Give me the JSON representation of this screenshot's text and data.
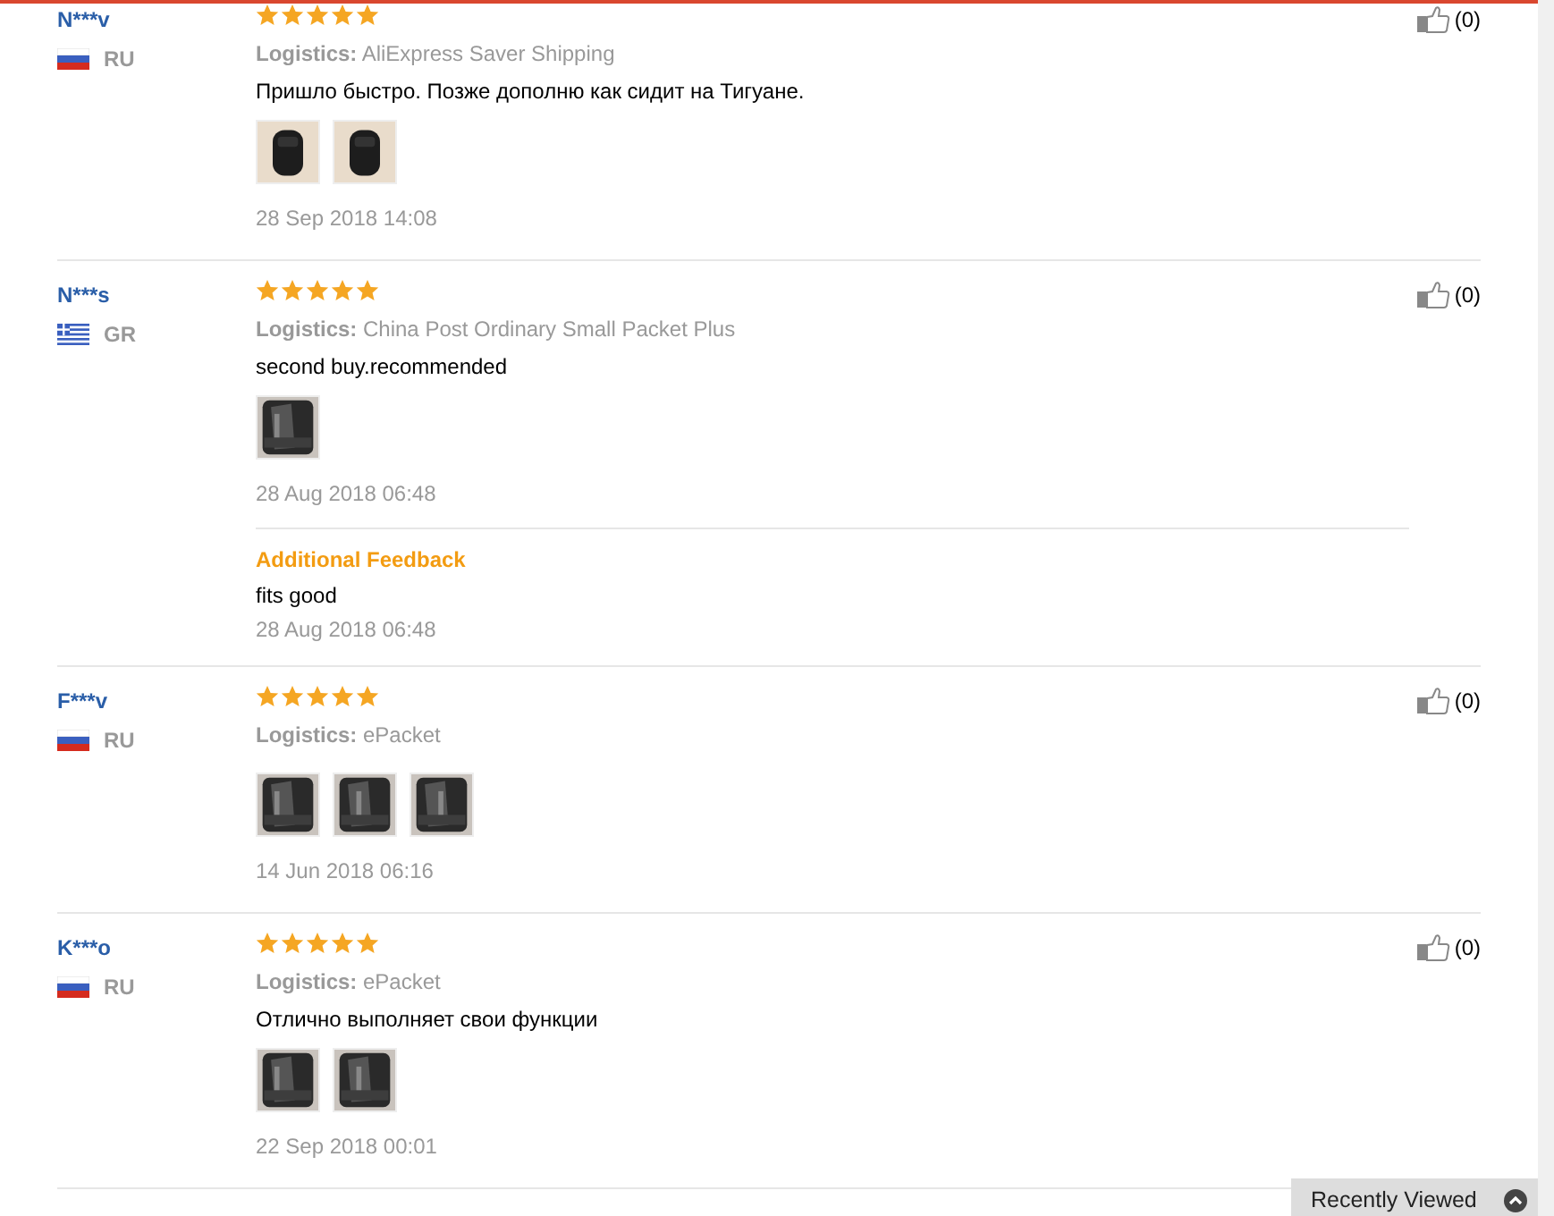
{
  "reviews": [
    {
      "name": "N***v",
      "flag": {
        "kind": "ru"
      },
      "country": "RU",
      "stars": 5,
      "logistics_label": "Logistics:",
      "logistics": "AliExpress Saver Shipping",
      "text": "Пришло быстро. Позже дополню как сидит на Тигуане.",
      "photos": [
        {
          "kind": "picture"
        },
        {
          "kind": "picture"
        }
      ],
      "date": "28 Sep 2018 14:08",
      "likes": "(0)"
    },
    {
      "name": "N***s",
      "flag": {
        "kind": "gr"
      },
      "country": "GR",
      "stars": 5,
      "logistics_label": "Logistics:",
      "logistics": "China Post Ordinary Small Packet Plus",
      "text": "second buy.recommended",
      "photos": [
        {
          "kind": "picture"
        }
      ],
      "date": "28 Aug 2018 06:48",
      "additional": {
        "title": "Additional Feedback",
        "text": "fits good",
        "date": "28 Aug 2018 06:48"
      },
      "likes": "(0)"
    },
    {
      "name": "F***v",
      "flag": {
        "kind": "ru"
      },
      "country": "RU",
      "stars": 5,
      "logistics_label": "Logistics:",
      "logistics": "ePacket",
      "photos": [
        {
          "kind": "picture"
        },
        {
          "kind": "picture"
        },
        {
          "kind": "picture"
        }
      ],
      "date": "14 Jun 2018 06:16",
      "likes": "(0)"
    },
    {
      "name": "K***o",
      "flag": {
        "kind": "ru"
      },
      "country": "RU",
      "stars": 5,
      "logistics_label": "Logistics:",
      "logistics": "ePacket",
      "text": "Отлично выполняет свои функции",
      "photos": [
        {
          "kind": "picture"
        },
        {
          "kind": "picture"
        }
      ],
      "date": "22 Sep 2018 00:01",
      "likes": "(0)"
    }
  ],
  "recently_viewed": {
    "label": "Recently Viewed"
  }
}
